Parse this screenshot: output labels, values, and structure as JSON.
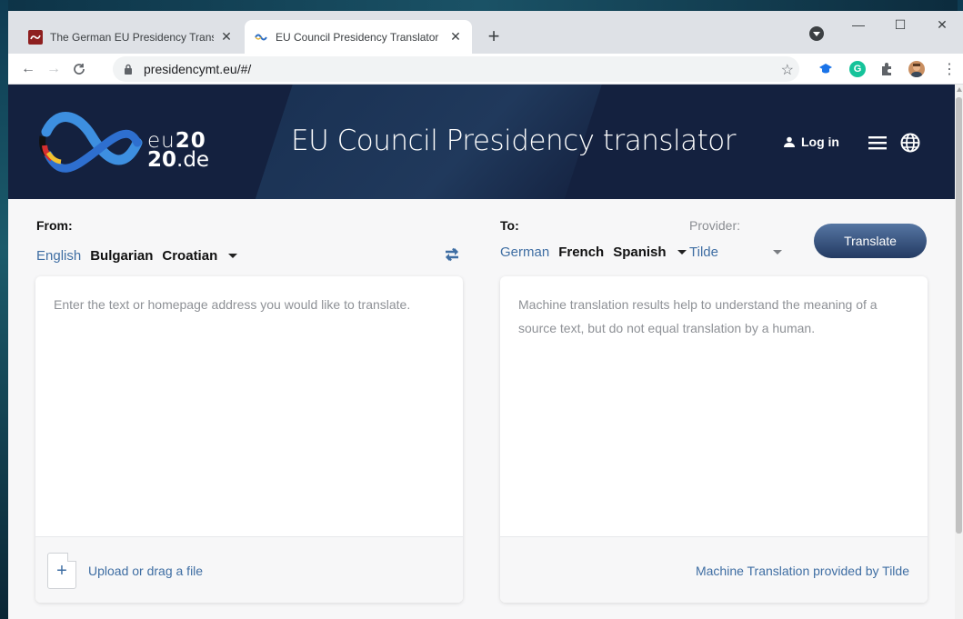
{
  "browser": {
    "tabs": [
      {
        "title": "The German EU Presidency Transl",
        "favicon": "eu2020-red-icon"
      },
      {
        "title": "EU Council Presidency Translator",
        "favicon": "eu2020-logo-icon"
      }
    ],
    "new_tab_label": "+",
    "url": "presidencymt.eu/#/",
    "window_controls": {
      "minimize": "—",
      "maximize": "☐",
      "close": "✕"
    }
  },
  "header": {
    "logo_line1_light": "eu",
    "logo_line1_bold": "20",
    "logo_line2_bold": "20",
    "logo_line2_light": ".de",
    "title": "EU Council Presidency translator",
    "login_label": "Log in"
  },
  "source": {
    "label": "From:",
    "languages": [
      "English",
      "Bulgarian",
      "Croatian"
    ],
    "selected": "English",
    "placeholder": "Enter the text or homepage address you would like to translate.",
    "upload_label": "Upload or drag a file"
  },
  "target": {
    "label": "To:",
    "languages": [
      "German",
      "French",
      "Spanish"
    ],
    "selected": "German",
    "provider_label": "Provider:",
    "provider_value": "Tilde",
    "placeholder": "Machine translation results help to understand the meaning of a source text, but do not equal translation by a human.",
    "provided_by": "Machine Translation provided by Tilde"
  },
  "actions": {
    "translate_label": "Translate"
  },
  "colors": {
    "header_bg": "#14213f",
    "accent": "#3f6ea3",
    "button": "#2f4a75"
  }
}
